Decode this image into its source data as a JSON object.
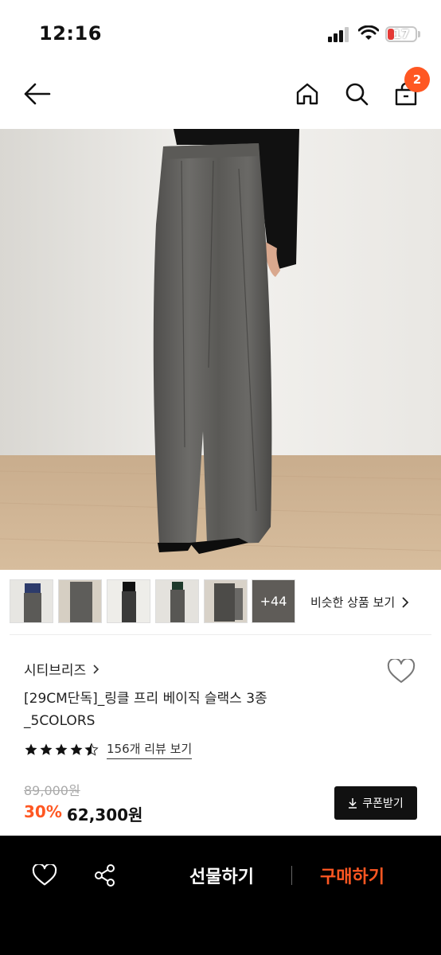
{
  "status_bar": {
    "time": "12:16",
    "battery": "17"
  },
  "header": {
    "cart_count": "2",
    "icons": [
      "back-arrow-icon",
      "home-icon",
      "search-icon",
      "shopping-bag-icon"
    ]
  },
  "thumbnails": {
    "more_label": "+44",
    "similar_label": "비슷한 상품 보기"
  },
  "product": {
    "brand": "시티브리즈",
    "title_line1": "[29CM단독]_링클 프리 베이직 슬랙스 3종",
    "title_line2": "_5COLORS",
    "rating": 4.5,
    "review_label": "156개 리뷰 보기",
    "original_price": "89,000원",
    "discount": "30%",
    "price": "62,300원",
    "coupon_label": "쿠폰받기"
  },
  "bottom_bar": {
    "gift_label": "선물하기",
    "buy_label": "구매하기"
  },
  "colors": {
    "accent": "#ff5722",
    "dark": "#000000"
  }
}
